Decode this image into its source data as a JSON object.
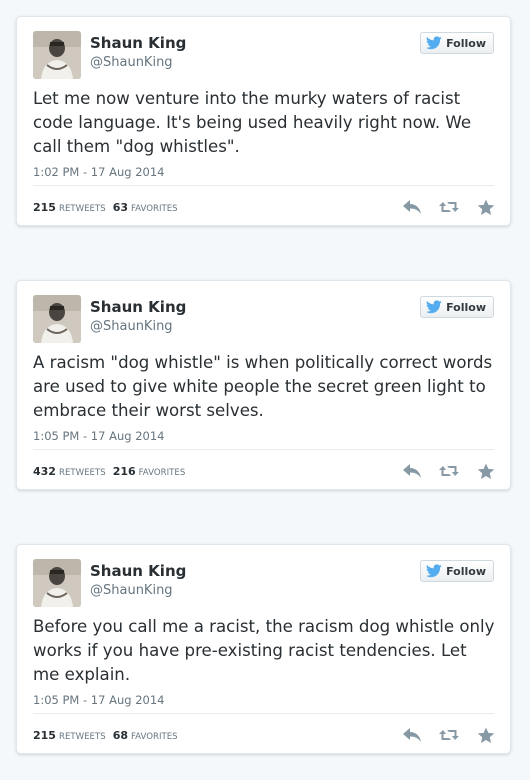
{
  "colors": {
    "background": "#f5f8fa",
    "card": "#ffffff",
    "text": "#292f33",
    "muted": "#66757f",
    "bird": "#55acee",
    "action_icon": "#8899a6"
  },
  "tweets": [
    {
      "author": "Shaun King",
      "handle": "@ShaunKing",
      "follow_label": "Follow",
      "text": "Let me now venture into the murky waters of racist code language. It's being used heavily right now. We call them \"dog whistles\".",
      "timestamp": "1:02 PM - 17 Aug 2014",
      "retweets": "215",
      "retweets_label": "RETWEETS",
      "favorites": "63",
      "favorites_label": "FAVORITES",
      "actions": [
        "reply-icon",
        "retweet-icon",
        "favorite-star-icon"
      ]
    },
    {
      "author": "Shaun King",
      "handle": "@ShaunKing",
      "follow_label": "Follow",
      "text": "A racism \"dog whistle\" is when politically correct words are used to give white people the secret green light to embrace their worst selves.",
      "timestamp": "1:05 PM - 17 Aug 2014",
      "retweets": "432",
      "retweets_label": "RETWEETS",
      "favorites": "216",
      "favorites_label": "FAVORITES",
      "actions": [
        "reply-icon",
        "retweet-icon",
        "favorite-star-icon"
      ]
    },
    {
      "author": "Shaun King",
      "handle": "@ShaunKing",
      "follow_label": "Follow",
      "text": "Before you call me a racist, the racism dog whistle only works if you have pre-existing racist tendencies. Let me explain.",
      "timestamp": "1:05 PM - 17 Aug 2014",
      "retweets": "215",
      "retweets_label": "RETWEETS",
      "favorites": "68",
      "favorites_label": "FAVORITES",
      "actions": [
        "reply-icon",
        "retweet-icon",
        "favorite-star-icon"
      ]
    }
  ]
}
